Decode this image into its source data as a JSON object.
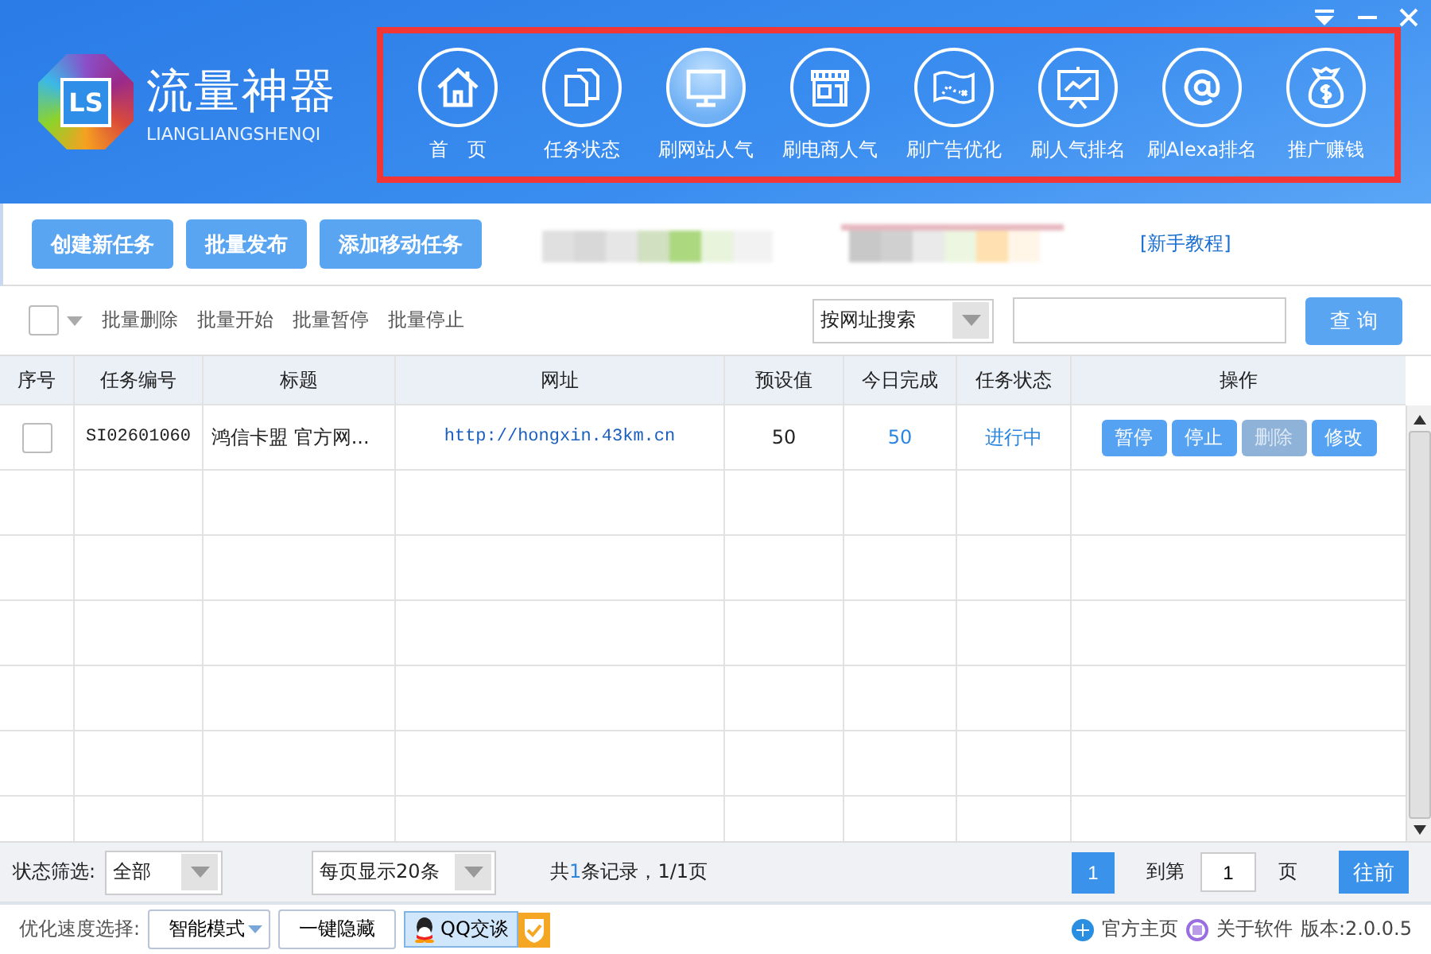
{
  "app": {
    "logo_mark": "LS",
    "title": "流量神器",
    "subtitle": "LIANGLIANGSHENQI"
  },
  "nav": [
    {
      "label": "首　页",
      "kind": "home",
      "selected": false
    },
    {
      "label": "任务状态",
      "kind": "docs",
      "selected": false
    },
    {
      "label": "刷网站人气",
      "kind": "monitor",
      "selected": true
    },
    {
      "label": "刷电商人气",
      "kind": "store",
      "selected": false
    },
    {
      "label": "刷广告优化",
      "kind": "map",
      "selected": false
    },
    {
      "label": "刷人气排名",
      "kind": "chart",
      "selected": false
    },
    {
      "label": "刷Alexa排名",
      "kind": "at",
      "selected": false
    },
    {
      "label": "推广赚钱",
      "kind": "money",
      "selected": false
    }
  ],
  "toolbar": {
    "buttons": [
      "创建新任务",
      "批量发布",
      "添加移动任务"
    ],
    "tutorial_link": "[新手教程]"
  },
  "batch": {
    "select_all_checked": false,
    "actions": [
      "批量删除",
      "批量开始",
      "批量暂停",
      "批量停止"
    ]
  },
  "search": {
    "mode": "按网址搜索",
    "button": "查 询"
  },
  "table": {
    "columns": [
      "序号",
      "任务编号",
      "标题",
      "网址",
      "预设值",
      "今日完成",
      "任务状态",
      "操作"
    ],
    "rows": [
      {
        "checked": false,
        "id": "SI02601060",
        "title": "鸿信卡盟 官方网...",
        "url": "http://hongxin.43km.cn",
        "preset": "50",
        "today": "50",
        "status": "进行中",
        "actions": [
          {
            "label": "暂停",
            "disabled": false
          },
          {
            "label": "停止",
            "disabled": false
          },
          {
            "label": "删除",
            "disabled": true
          },
          {
            "label": "修改",
            "disabled": false
          }
        ]
      }
    ]
  },
  "footer": {
    "filter_label": "状态筛选:",
    "filter_value": "全部",
    "page_size": "每页显示20条",
    "records_prefix": "共",
    "records_count": "1",
    "records_suffix": "条记录，1/1页",
    "pages": [
      {
        "label": "1",
        "selected": true
      }
    ],
    "goto_label": "到第",
    "goto_value": "1",
    "page_unit": "页",
    "go_button": "往前"
  },
  "bottom_bar": {
    "speed_label": "优化速度选择:",
    "speed_mode": "智能模式",
    "hide_button": "一键隐藏",
    "qq_button": "QQ交谈",
    "home_link": "官方主页",
    "about_link": "关于软件",
    "version": "版本:2.0.0.5"
  }
}
